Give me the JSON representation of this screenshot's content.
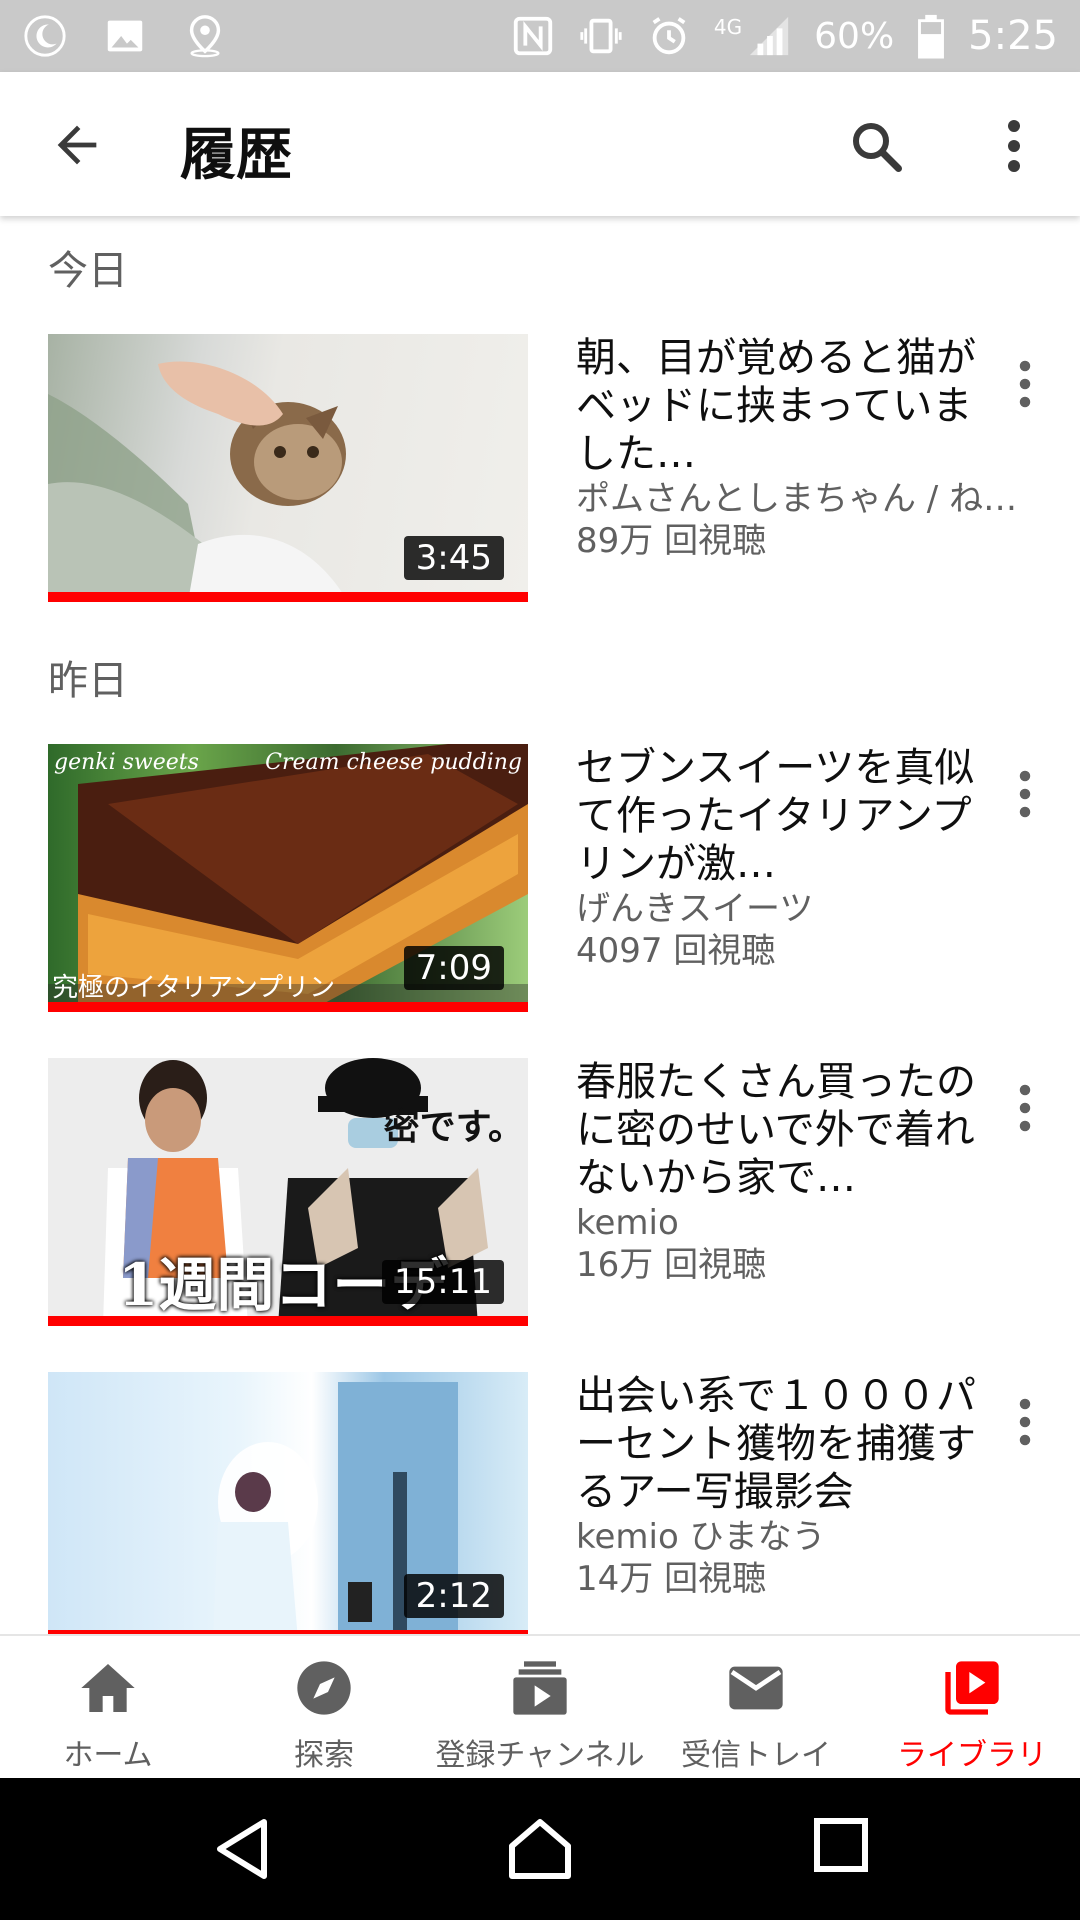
{
  "status_bar": {
    "battery": "60%",
    "network": "4G",
    "time": "5:25"
  },
  "app_bar": {
    "title": "履歴"
  },
  "sections": [
    {
      "header": "今日",
      "videos": [
        {
          "title": "朝、目が覚めると猫がベッドに挟まっていました…",
          "channel": "ポムさんとしまちゃん / ね…",
          "views": "89万 回視聴",
          "duration": "3:45",
          "progress": 1.0
        }
      ]
    },
    {
      "header": "昨日",
      "videos": [
        {
          "title": "セブンスイーツを真似て作ったイタリアンプリンが激…",
          "channel": "げんきスイーツ",
          "views": "4097 回視聴",
          "duration": "7:09",
          "progress": 1.0,
          "thumb_text": [
            "genki sweets",
            "Cream cheese pudding",
            "究極のイタリアンプリン"
          ]
        },
        {
          "title": "春服たくさん買ったのに密のせいで外で着れないから家で…",
          "channel": "kemio",
          "views": "16万 回視聴",
          "duration": "15:11",
          "progress": 1.0,
          "thumb_text": [
            "密です。",
            "1週間コーデ"
          ]
        },
        {
          "title": "出会い系で１０００パーセント獲物を捕獲するアー写撮影会",
          "channel": "kemio ひまなう",
          "views": "14万 回視聴",
          "duration": "2:12",
          "progress": 1.0
        }
      ]
    }
  ],
  "bottom_nav": [
    {
      "label": "ホーム",
      "icon": "home-icon"
    },
    {
      "label": "探索",
      "icon": "explore-icon"
    },
    {
      "label": "登録チャンネル",
      "icon": "subscriptions-icon"
    },
    {
      "label": "受信トレイ",
      "icon": "inbox-icon"
    },
    {
      "label": "ライブラリ",
      "icon": "library-icon",
      "active": true
    }
  ],
  "colors": {
    "accent": "#ff0000",
    "secondary_text": "#606060",
    "status_bar": "#c9c9c9"
  }
}
